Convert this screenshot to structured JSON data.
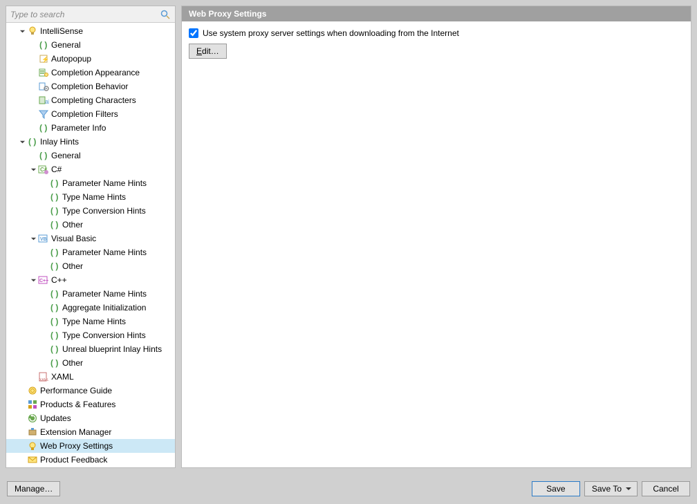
{
  "search": {
    "placeholder": "Type to search"
  },
  "header": {
    "title": "Web Proxy Settings"
  },
  "content": {
    "checkbox_label": "Use system proxy server settings when downloading from the Internet",
    "checkbox_checked": true,
    "edit_label": "Edit…"
  },
  "footer": {
    "manage": "Manage…",
    "save": "Save",
    "save_to": "Save To",
    "cancel": "Cancel"
  },
  "tree": [
    {
      "depth": 1,
      "expander": "open",
      "icon": "bulb",
      "label": "IntelliSense"
    },
    {
      "depth": 2,
      "expander": "none",
      "icon": "paren",
      "label": "General"
    },
    {
      "depth": 2,
      "expander": "none",
      "icon": "auto",
      "label": "Autopopup"
    },
    {
      "depth": 2,
      "expander": "none",
      "icon": "comp-appear",
      "label": "Completion Appearance"
    },
    {
      "depth": 2,
      "expander": "none",
      "icon": "comp-behav",
      "label": "Completion Behavior"
    },
    {
      "depth": 2,
      "expander": "none",
      "icon": "comp-chars",
      "label": "Completing Characters"
    },
    {
      "depth": 2,
      "expander": "none",
      "icon": "filter",
      "label": "Completion Filters"
    },
    {
      "depth": 2,
      "expander": "none",
      "icon": "paren",
      "label": "Parameter Info"
    },
    {
      "depth": 1,
      "expander": "open",
      "icon": "paren",
      "label": "Inlay Hints"
    },
    {
      "depth": 2,
      "expander": "none",
      "icon": "paren",
      "label": "General"
    },
    {
      "depth": 2,
      "expander": "open",
      "icon": "csharp",
      "label": "C#"
    },
    {
      "depth": 3,
      "expander": "none",
      "icon": "paren",
      "label": "Parameter Name Hints"
    },
    {
      "depth": 3,
      "expander": "none",
      "icon": "paren",
      "label": "Type Name Hints"
    },
    {
      "depth": 3,
      "expander": "none",
      "icon": "paren",
      "label": "Type Conversion Hints"
    },
    {
      "depth": 3,
      "expander": "none",
      "icon": "paren",
      "label": "Other"
    },
    {
      "depth": 2,
      "expander": "open",
      "icon": "vb",
      "label": "Visual Basic"
    },
    {
      "depth": 3,
      "expander": "none",
      "icon": "paren",
      "label": "Parameter Name Hints"
    },
    {
      "depth": 3,
      "expander": "none",
      "icon": "paren",
      "label": "Other"
    },
    {
      "depth": 2,
      "expander": "open",
      "icon": "cpp",
      "label": "C++"
    },
    {
      "depth": 3,
      "expander": "none",
      "icon": "paren",
      "label": "Parameter Name Hints"
    },
    {
      "depth": 3,
      "expander": "none",
      "icon": "paren",
      "label": "Aggregate Initialization"
    },
    {
      "depth": 3,
      "expander": "none",
      "icon": "paren",
      "label": "Type Name Hints"
    },
    {
      "depth": 3,
      "expander": "none",
      "icon": "paren",
      "label": "Type Conversion Hints"
    },
    {
      "depth": 3,
      "expander": "none",
      "icon": "paren",
      "label": "Unreal blueprint Inlay Hints"
    },
    {
      "depth": 3,
      "expander": "none",
      "icon": "paren",
      "label": "Other"
    },
    {
      "depth": 2,
      "expander": "none",
      "icon": "xaml",
      "label": "XAML"
    },
    {
      "depth": 1,
      "expander": "none",
      "icon": "snail",
      "label": "Performance Guide"
    },
    {
      "depth": 1,
      "expander": "none",
      "icon": "grid",
      "label": "Products & Features"
    },
    {
      "depth": 1,
      "expander": "none",
      "icon": "update",
      "label": "Updates"
    },
    {
      "depth": 1,
      "expander": "none",
      "icon": "ext",
      "label": "Extension Manager"
    },
    {
      "depth": 1,
      "expander": "none",
      "icon": "proxy",
      "label": "Web Proxy Settings",
      "selected": true
    },
    {
      "depth": 1,
      "expander": "none",
      "icon": "mail",
      "label": "Product Feedback"
    }
  ]
}
